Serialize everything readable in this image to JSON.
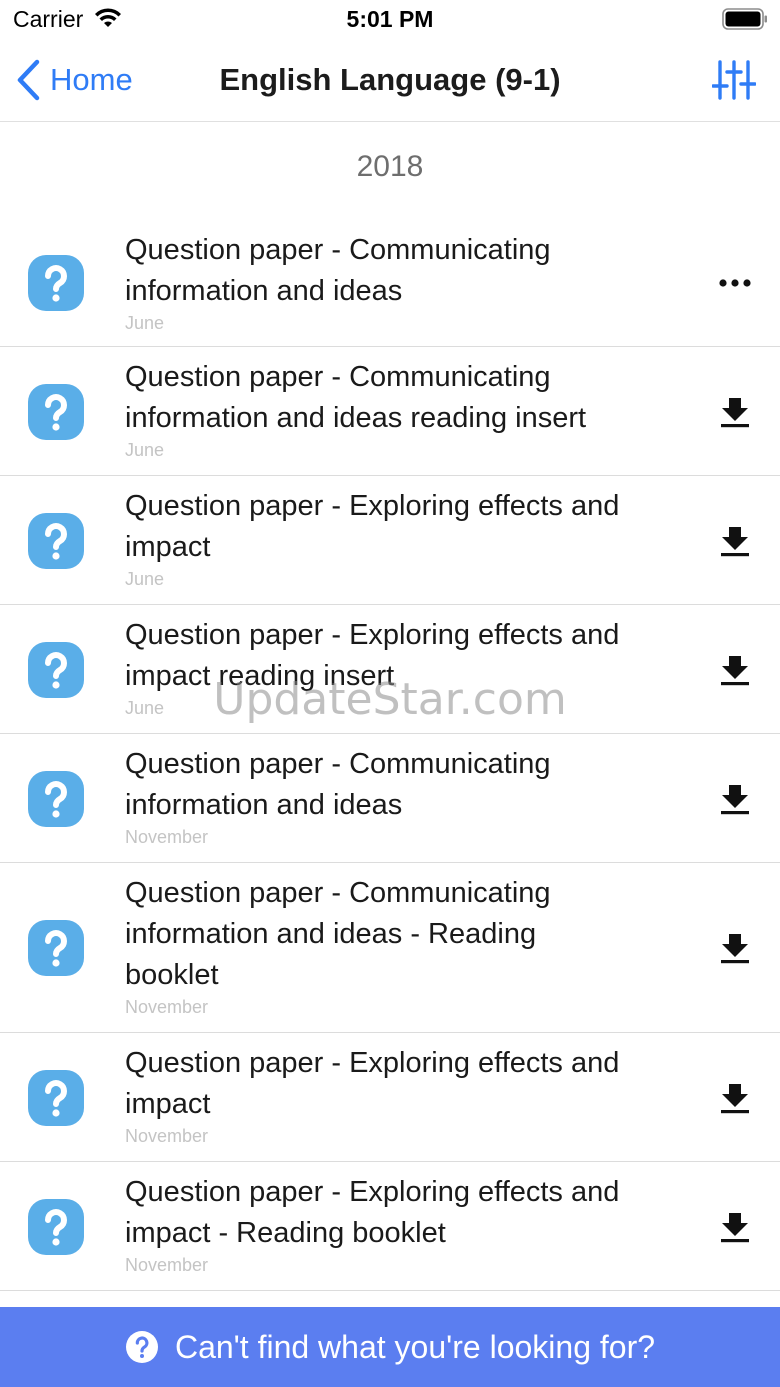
{
  "status_bar": {
    "carrier": "Carrier",
    "time": "5:01 PM"
  },
  "nav": {
    "back_label": "Home",
    "title": "English Language (9-1)"
  },
  "section": {
    "year": "2018"
  },
  "items": [
    {
      "title_line1": "Question paper - Communicating",
      "title_line2": "information and ideas",
      "title_line3": "",
      "session": "June",
      "action": "more"
    },
    {
      "title_line1": "Question paper - Communicating",
      "title_line2": "information and ideas reading insert",
      "title_line3": "",
      "session": "June",
      "action": "download"
    },
    {
      "title_line1": "Question paper - Exploring effects and",
      "title_line2": "impact",
      "title_line3": "",
      "session": "June",
      "action": "download"
    },
    {
      "title_line1": "Question paper - Exploring effects and",
      "title_line2": "impact reading insert",
      "title_line3": "",
      "session": "June",
      "action": "download"
    },
    {
      "title_line1": "Question paper - Communicating",
      "title_line2": "information and ideas",
      "title_line3": "",
      "session": "November",
      "action": "download"
    },
    {
      "title_line1": "Question paper - Communicating",
      "title_line2": "information and ideas - Reading",
      "title_line3": "booklet",
      "session": "November",
      "action": "download"
    },
    {
      "title_line1": "Question paper - Exploring effects and",
      "title_line2": "impact",
      "title_line3": "",
      "session": "November",
      "action": "download"
    },
    {
      "title_line1": "Question paper - Exploring effects and",
      "title_line2": "impact - Reading booklet",
      "title_line3": "",
      "session": "November",
      "action": "download"
    }
  ],
  "watermark": "UpdateStar.com",
  "footer": {
    "label": "Can't find what you're looking for?"
  },
  "colors": {
    "accent": "#2f7cf6",
    "footer_bg": "#5b7ef0",
    "question_icon": "#5aaee8"
  },
  "icons": {
    "back": "chevron-left-icon",
    "filter": "sliders-icon",
    "item": "question-mark-icon",
    "more": "ellipsis-icon",
    "download": "download-icon",
    "footer": "help-circle-icon"
  }
}
